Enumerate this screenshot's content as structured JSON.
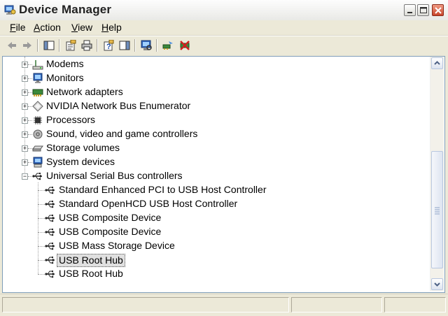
{
  "window": {
    "title": "Device Manager"
  },
  "menubar": {
    "items": [
      {
        "pre": "",
        "key": "F",
        "rest": "ile"
      },
      {
        "pre": "",
        "key": "A",
        "rest": "ction"
      },
      {
        "pre": "",
        "key": "V",
        "rest": "iew"
      },
      {
        "pre": "",
        "key": "H",
        "rest": "elp"
      }
    ]
  },
  "toolbar": {
    "buttons": [
      "back-arrow-icon",
      "forward-arrow-icon",
      "show-hide-console-tree-icon",
      "properties-icon",
      "print-icon",
      "help-icon",
      "show-hide-action-pane-icon",
      "scan-hardware-changes-icon",
      "update-driver-icon",
      "uninstall-icon"
    ]
  },
  "tree": {
    "categories": [
      {
        "label": "Modems",
        "icon": "modem-icon",
        "expanded": false
      },
      {
        "label": "Monitors",
        "icon": "monitor-icon",
        "expanded": false
      },
      {
        "label": "Network adapters",
        "icon": "network-adapter-icon",
        "expanded": false
      },
      {
        "label": "NVIDIA Network Bus Enumerator",
        "icon": "bus-enumerator-icon",
        "expanded": false
      },
      {
        "label": "Processors",
        "icon": "processor-icon",
        "expanded": false
      },
      {
        "label": "Sound, video and game controllers",
        "icon": "sound-icon",
        "expanded": false
      },
      {
        "label": "Storage volumes",
        "icon": "storage-volume-icon",
        "expanded": false
      },
      {
        "label": "System devices",
        "icon": "system-device-icon",
        "expanded": false
      },
      {
        "label": "Universal Serial Bus controllers",
        "icon": "usb-icon",
        "expanded": true
      }
    ],
    "usb_children": [
      {
        "label": "Standard Enhanced PCI to USB Host Controller",
        "selected": false
      },
      {
        "label": "Standard OpenHCD USB Host Controller",
        "selected": false
      },
      {
        "label": "USB Composite Device",
        "selected": false
      },
      {
        "label": "USB Composite Device",
        "selected": false
      },
      {
        "label": "USB Mass Storage Device",
        "selected": false
      },
      {
        "label": "USB Root Hub",
        "selected": true
      },
      {
        "label": "USB Root Hub",
        "selected": false
      }
    ]
  },
  "scrollbar": {
    "thumb_position": 0.72
  }
}
